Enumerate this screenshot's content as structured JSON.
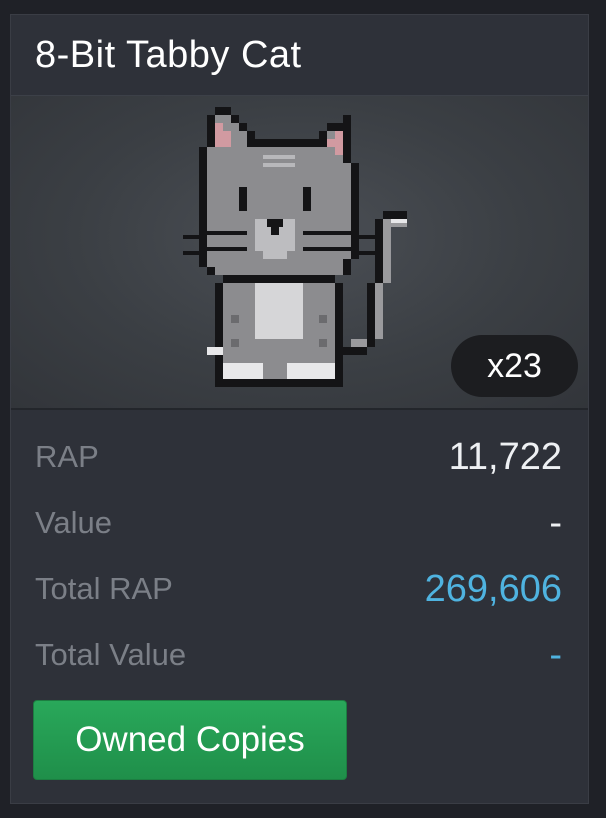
{
  "item": {
    "title": "8-Bit Tabby Cat",
    "count": "x23",
    "thumbnail_icon": "pixel-tabby-cat-icon"
  },
  "stats": [
    {
      "label": "RAP",
      "value": "11,722",
      "accent": false
    },
    {
      "label": "Value",
      "value": "-",
      "accent": false
    },
    {
      "label": "Total RAP",
      "value": "269,606",
      "accent": true
    },
    {
      "label": "Total Value",
      "value": "-",
      "accent": true
    }
  ],
  "actions": {
    "owned_copies_label": "Owned Copies"
  },
  "colors": {
    "accent_blue": "#4fb3e0",
    "button_green": "#1f8f4a",
    "card_bg": "#2e3139"
  }
}
